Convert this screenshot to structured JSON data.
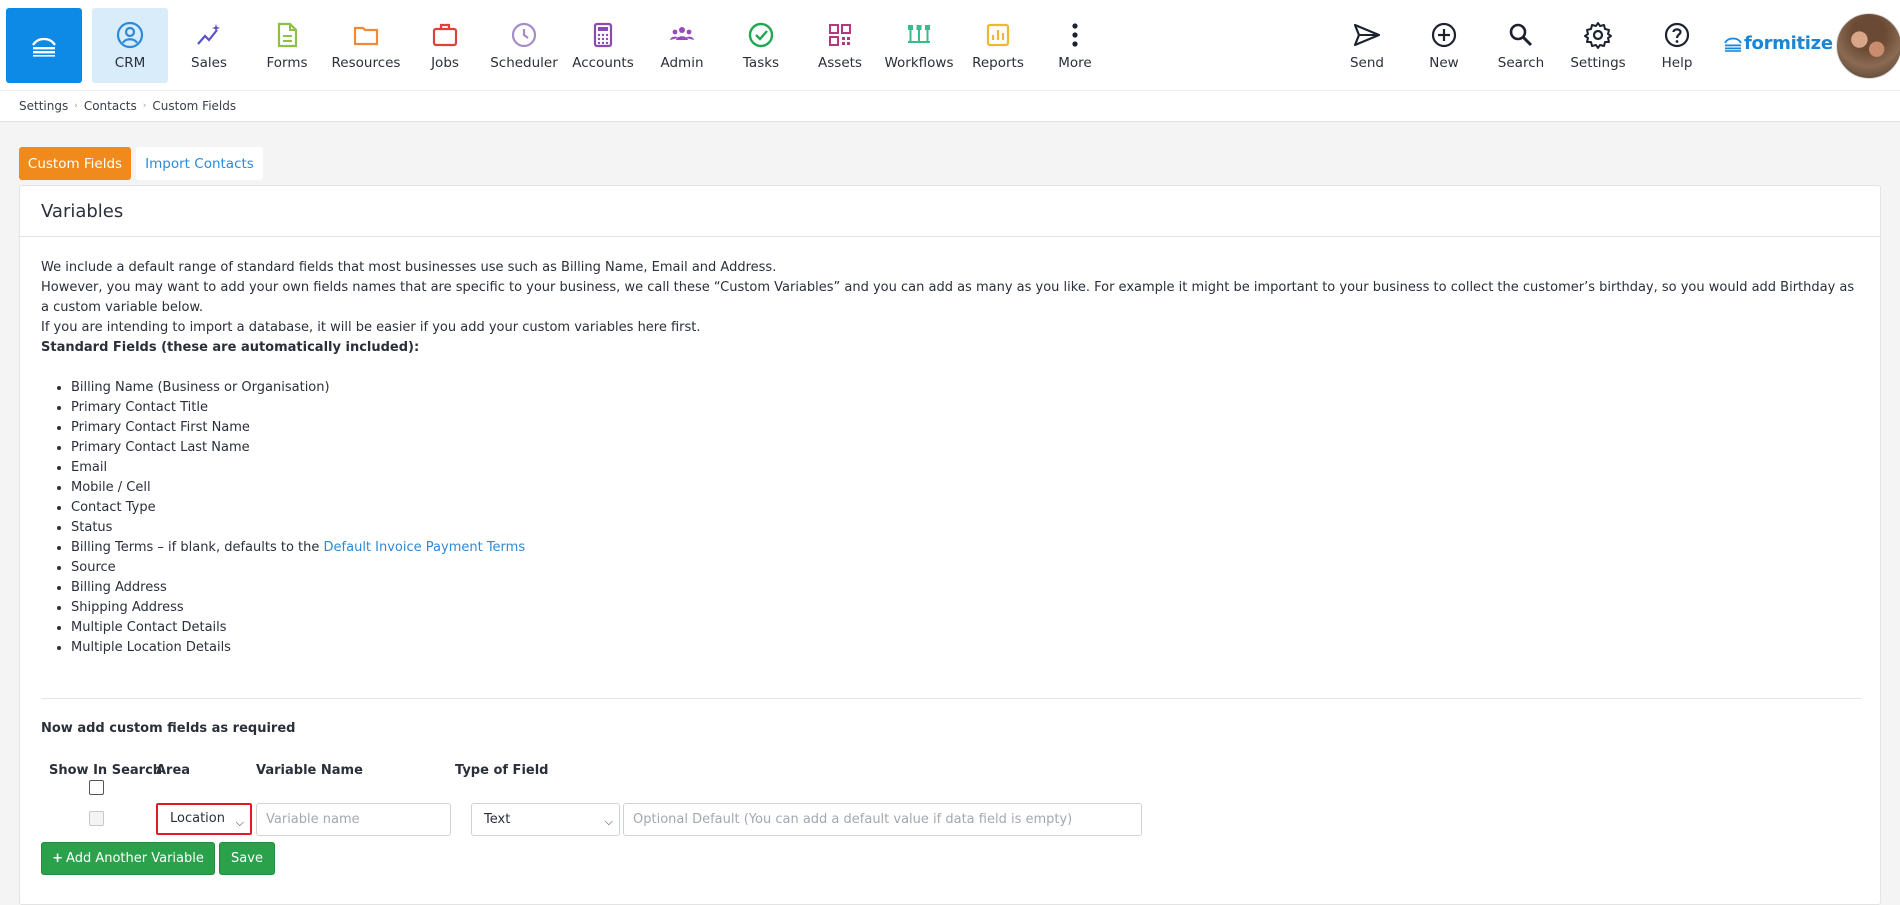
{
  "nav": {
    "items": [
      {
        "label": "CRM",
        "icon": "user-circle-icon",
        "color": "#2d8ad8"
      },
      {
        "label": "Sales",
        "icon": "trend-sparkle-icon",
        "color": "#5a52c7"
      },
      {
        "label": "Forms",
        "icon": "document-icon",
        "color": "#8cc04a"
      },
      {
        "label": "Resources",
        "icon": "folder-icon",
        "color": "#f08a3a"
      },
      {
        "label": "Jobs",
        "icon": "briefcase-icon",
        "color": "#e0403a"
      },
      {
        "label": "Scheduler",
        "icon": "clock-icon",
        "color": "#a58cc8"
      },
      {
        "label": "Accounts",
        "icon": "calculator-icon",
        "color": "#8a4ab0"
      },
      {
        "label": "Admin",
        "icon": "users-icon",
        "color": "#9a4ab8"
      },
      {
        "label": "Tasks",
        "icon": "check-circle-icon",
        "color": "#22a653"
      },
      {
        "label": "Assets",
        "icon": "qr-code-icon",
        "color": "#b33a7a"
      },
      {
        "label": "Workflows",
        "icon": "workflow-icon",
        "color": "#3cba8a"
      },
      {
        "label": "Reports",
        "icon": "bar-chart-icon",
        "color": "#f0b730"
      },
      {
        "label": "More",
        "icon": "more-vertical-icon",
        "color": "#2a2f3a"
      }
    ],
    "right": [
      {
        "label": "Send",
        "icon": "send-icon"
      },
      {
        "label": "New",
        "icon": "plus-circle-icon"
      },
      {
        "label": "Search",
        "icon": "search-icon"
      },
      {
        "label": "Settings",
        "icon": "gear-icon"
      },
      {
        "label": "Help",
        "icon": "help-circle-icon"
      }
    ],
    "brand": "formitize"
  },
  "breadcrumb": [
    "Settings",
    "Contacts",
    "Custom Fields"
  ],
  "tabs": {
    "custom_fields": "Custom Fields",
    "import_contacts": "Import Contacts"
  },
  "panel": {
    "title": "Variables",
    "intro_1": "We include a default range of standard fields that most businesses use such as Billing Name, Email and Address.",
    "intro_2": "However, you may want to add your own fields names that are specific to your business, we call these “Custom Variables” and you can add as many as you like. For example it might be important to your business to collect the customer’s birthday, so you would add Birthday as a custom variable below.",
    "intro_3": "If you are intending to import a database, it will be easier if you add your custom variables here first.",
    "standard_heading": "Standard Fields (these are automatically included):",
    "standard_fields": [
      "Billing Name (Business or Organisation)",
      "Primary Contact Title",
      "Primary Contact First Name",
      "Primary Contact Last Name",
      "Email",
      "Mobile / Cell",
      "Contact Type",
      "Status",
      "Billing Terms – if blank, defaults to the ",
      "Source",
      "Billing Address",
      "Shipping Address",
      "Multiple Contact Details",
      "Multiple Location Details"
    ],
    "billing_terms_link": "Default Invoice Payment Terms",
    "now_add": "Now add custom fields as required",
    "columns": {
      "show_in_search": "Show In Search",
      "area": "Area",
      "variable_name": "Variable Name",
      "type_of_field": "Type of Field"
    },
    "row": {
      "area_value": "Location",
      "variable_placeholder": "Variable name",
      "type_value": "Text",
      "default_placeholder": "Optional Default (You can add a default value if data field is empty)"
    },
    "buttons": {
      "add_another": "Add Another Variable",
      "save": "Save"
    }
  }
}
